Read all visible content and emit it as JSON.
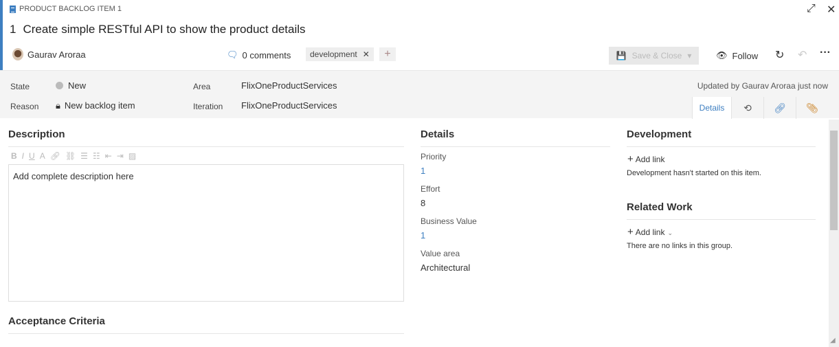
{
  "header": {
    "work_item_type": "PRODUCT BACKLOG ITEM 1",
    "id": "1",
    "title": "Create simple RESTful API to show the product details",
    "assigned_to": "Gaurav Aroraa",
    "comments": "0 comments",
    "tags": [
      "development"
    ],
    "save_label": "Save & Close",
    "follow_label": "Follow",
    "accent_color": "#3e7fc1"
  },
  "fields": {
    "state_label": "State",
    "state_value": "New",
    "reason_label": "Reason",
    "reason_value": "New backlog item",
    "area_label": "Area",
    "area_value": "FlixOneProductServices",
    "iteration_label": "Iteration",
    "iteration_value": "FlixOneProductServices",
    "updated": "Updated by Gaurav Aroraa just now"
  },
  "tabs": [
    {
      "label": "Details",
      "active": true
    },
    {
      "icon": "history-icon"
    },
    {
      "icon": "link-icon"
    },
    {
      "icon": "attachment-icon"
    }
  ],
  "description": {
    "heading": "Description",
    "text": "Add complete description here"
  },
  "acceptance": {
    "heading": "Acceptance Criteria"
  },
  "details": {
    "heading": "Details",
    "priority_label": "Priority",
    "priority": "1",
    "effort_label": "Effort",
    "effort": "8",
    "business_value_label": "Business Value",
    "business_value": "1",
    "value_area_label": "Value area",
    "value_area": "Architectural"
  },
  "development": {
    "heading": "Development",
    "add_link": "Add link",
    "note": "Development hasn't started on this item."
  },
  "related": {
    "heading": "Related Work",
    "add_link": "Add link",
    "note": "There are no links in this group."
  }
}
